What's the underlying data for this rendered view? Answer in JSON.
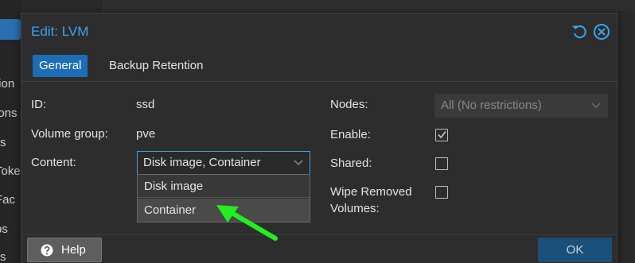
{
  "background": {
    "sidebar_fragments": [
      "tion",
      "ions",
      "s",
      "Toke",
      "Fac",
      "ps",
      "s"
    ]
  },
  "dialog": {
    "title": "Edit: LVM",
    "tabs": [
      {
        "label": "General",
        "active": true
      },
      {
        "label": "Backup Retention",
        "active": false
      }
    ],
    "form": {
      "id_label": "ID:",
      "id_value": "ssd",
      "volume_group_label": "Volume group:",
      "volume_group_value": "pve",
      "content_label": "Content:",
      "content_value": "Disk image, Container",
      "nodes_label": "Nodes:",
      "nodes_value": "All (No restrictions)",
      "enable_label": "Enable:",
      "enable_checked": true,
      "shared_label": "Shared:",
      "shared_checked": false,
      "wipe_label_line1": "Wipe Removed",
      "wipe_label_line2": "Volumes:",
      "wipe_checked": false
    },
    "content_dropdown": {
      "options": [
        "Disk image",
        "Container"
      ]
    },
    "footer": {
      "help_label": "Help",
      "ok_label": "OK"
    }
  },
  "colors": {
    "accent": "#3aa4ec",
    "active_tab": "#1c6db5",
    "ok_button": "#1a4f7a",
    "annotation_arrow": "#22ee22"
  }
}
